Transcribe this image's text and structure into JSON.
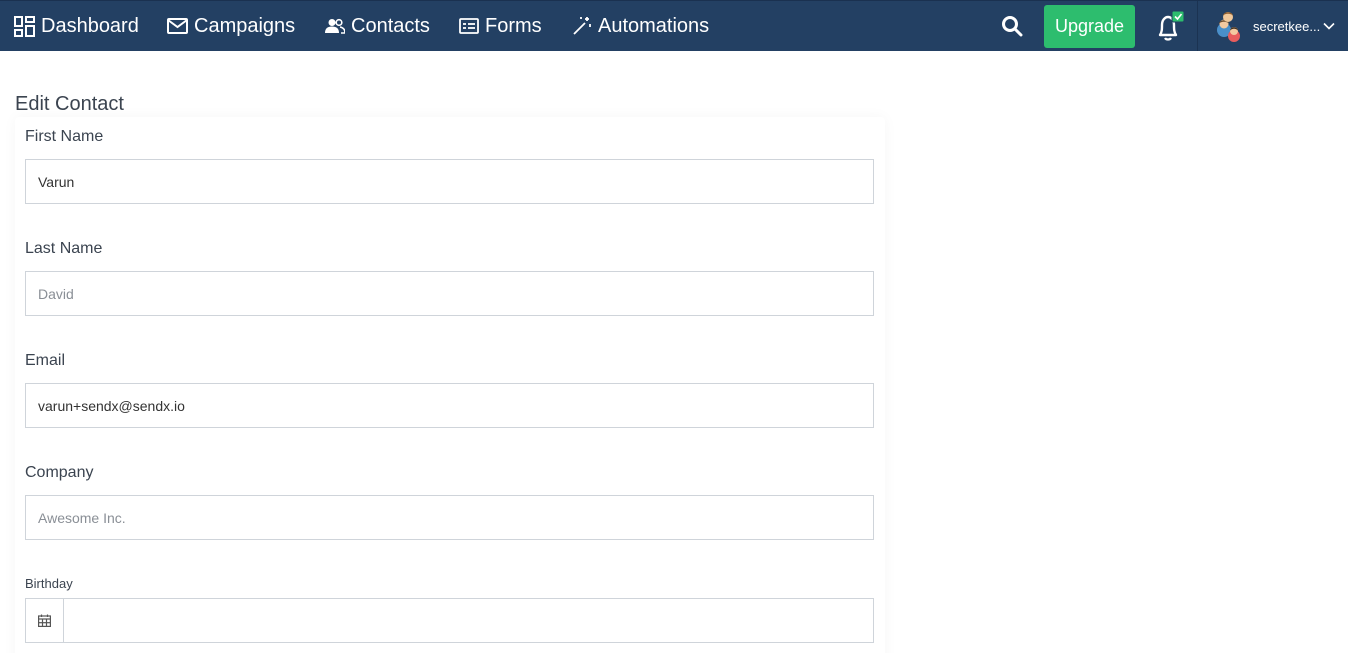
{
  "nav": {
    "items": [
      {
        "label": "Dashboard",
        "icon": "dashboard-icon"
      },
      {
        "label": "Campaigns",
        "icon": "envelope-icon"
      },
      {
        "label": "Contacts",
        "icon": "users-icon"
      },
      {
        "label": "Forms",
        "icon": "form-icon"
      },
      {
        "label": "Automations",
        "icon": "magic-wand-icon"
      }
    ],
    "upgrade_label": "Upgrade",
    "username": "secretkee..."
  },
  "page": {
    "title": "Edit Contact"
  },
  "form": {
    "first_name": {
      "label": "First Name",
      "value": "Varun",
      "placeholder": ""
    },
    "last_name": {
      "label": "Last Name",
      "value": "",
      "placeholder": "David"
    },
    "email": {
      "label": "Email",
      "value": "varun+sendx@sendx.io",
      "placeholder": ""
    },
    "company": {
      "label": "Company",
      "value": "",
      "placeholder": "Awesome Inc."
    },
    "birthday": {
      "label": "Birthday",
      "value": "",
      "placeholder": ""
    }
  },
  "colors": {
    "nav_bg": "#234063",
    "upgrade_bg": "#2dbd6e",
    "notification_badge": "#2dbd6e"
  }
}
